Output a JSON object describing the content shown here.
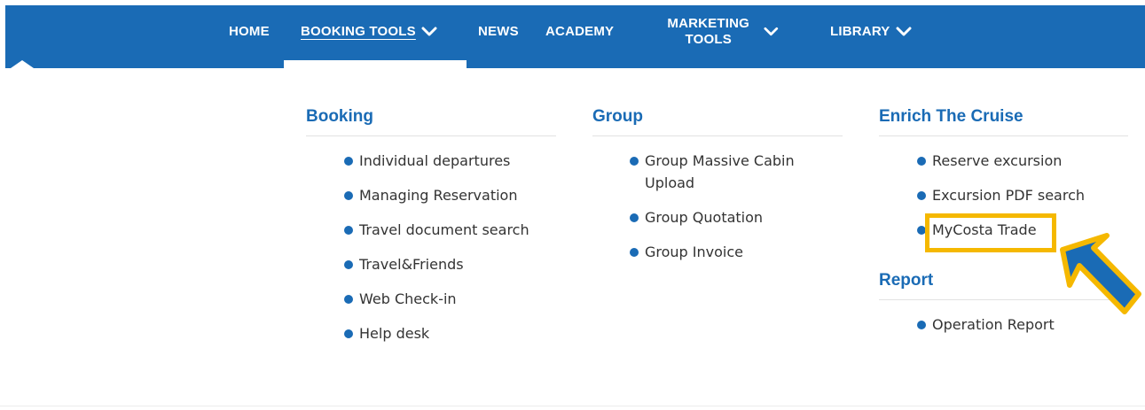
{
  "nav": {
    "items": [
      {
        "label": "HOME"
      },
      {
        "label": "BOOKING TOOLS"
      },
      {
        "label": "NEWS"
      },
      {
        "label": "ACADEMY"
      },
      {
        "label": "MARKETING TOOLS"
      },
      {
        "label": "LIBRARY"
      }
    ]
  },
  "menu": {
    "booking": {
      "title": "Booking",
      "items": [
        "Individual departures",
        "Managing Reservation",
        "Travel document search",
        "Travel&Friends",
        "Web Check-in",
        "Help desk"
      ]
    },
    "group": {
      "title": "Group",
      "items": [
        "Group Massive Cabin Upload",
        "Group Quotation",
        "Group Invoice"
      ]
    },
    "enrich": {
      "title": "Enrich The Cruise",
      "items": [
        "Reserve excursion",
        "Excursion PDF search",
        "MyCosta Trade"
      ]
    },
    "report": {
      "title": "Report",
      "items": [
        "Operation Report"
      ]
    }
  },
  "colors": {
    "brand_blue": "#1a6bb5",
    "highlight_yellow": "#f5b800",
    "text": "#333333"
  },
  "annotation": {
    "arrow_icon": "arrow-pointer-icon"
  }
}
